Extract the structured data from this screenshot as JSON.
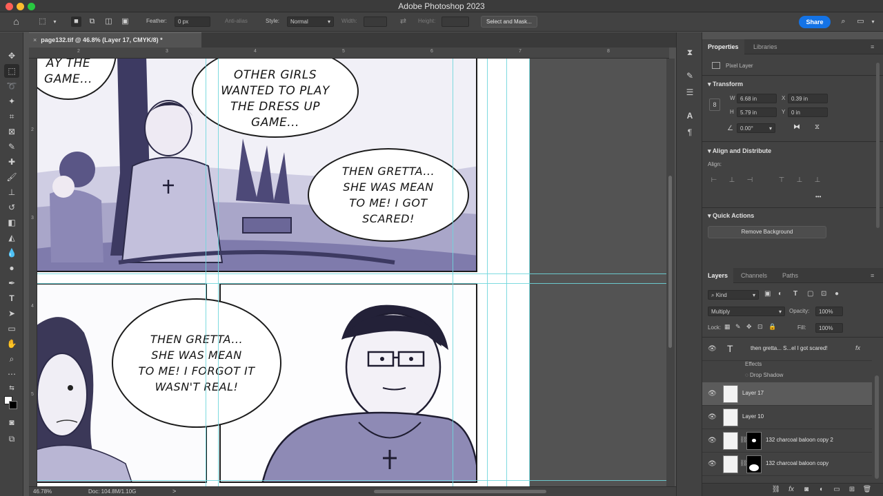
{
  "app": {
    "title": "Adobe Photoshop 2023"
  },
  "options_bar": {
    "feather_label": "Feather:",
    "feather_value": "0 px",
    "antialias_label": "Anti-alias",
    "style_label": "Style:",
    "style_value": "Normal",
    "width_label": "Width:",
    "height_label": "Height:",
    "select_mask_label": "Select and Mask...",
    "share_label": "Share"
  },
  "document": {
    "tab_title": "page132.tif @ 46.8% (Layer 17, CMYK/8) *",
    "close_glyph": "×",
    "ruler_numbers": [
      "2",
      "3",
      "4",
      "5",
      "6",
      "7",
      "8"
    ],
    "ruler_v_numbers": [
      "2",
      "3",
      "4",
      "5"
    ]
  },
  "comic": {
    "bubble1": "AY THE\nGAME...",
    "bubble2": "OTHER GIRLS\nWANTED TO PLAY\nTHE DRESS UP\nGAME...",
    "bubble3": "THEN GRETTA...\nSHE WAS MEAN\nTO ME! I GOT\nSCARED!",
    "bubble4": "THEN GRETTA...\nSHE WAS MEAN\nTO ME! I FORGOT IT\nWASN'T REAL!"
  },
  "status": {
    "zoom": "46.78%",
    "doc_size": "Doc: 104.8M/1.10G",
    "arrow": ">"
  },
  "properties": {
    "tabs": [
      "Properties",
      "Libraries"
    ],
    "layer_type": "Pixel Layer",
    "transform_header": "Transform",
    "w_label": "W",
    "w_value": "6.68 in",
    "h_label": "H",
    "h_value": "5.79 in",
    "x_label": "X",
    "x_value": "0.39 in",
    "y_label": "Y",
    "y_value": "0 in",
    "angle_value": "0.00°",
    "align_header": "Align and Distribute",
    "align_label": "Align:",
    "more_glyph": "•••",
    "quick_actions_header": "Quick Actions",
    "remove_bg_label": "Remove Background"
  },
  "layers_panel": {
    "tabs": [
      "Layers",
      "Channels",
      "Paths"
    ],
    "filter_kind": "Kind",
    "blend_mode": "Multiply",
    "opacity_label": "Opacity:",
    "opacity_value": "100%",
    "lock_label": "Lock:",
    "fill_label": "Fill:",
    "fill_value": "100%",
    "text_layer_name": "then gretta... S...el I got scared!",
    "fx_label": "fx",
    "effects_label": "Effects",
    "drop_shadow_label": "Drop Shadow",
    "layers": [
      {
        "name": "Layer 17",
        "selected": true,
        "mask": false
      },
      {
        "name": "Layer 10",
        "selected": false,
        "mask": false
      },
      {
        "name": "132 charcoal baloon copy 2",
        "selected": false,
        "mask": true
      },
      {
        "name": "132 charcoal baloon copy",
        "selected": false,
        "mask": true
      }
    ]
  },
  "colors": {
    "accent": "#1473e6",
    "guide": "#6fd6dc",
    "panel_bg": "#424242",
    "canvas_bg": "#535353"
  }
}
